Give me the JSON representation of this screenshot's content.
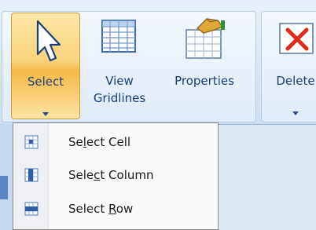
{
  "ribbon": {
    "select": {
      "label": "Select"
    },
    "view_gridlines": {
      "label_line1": "View",
      "label_line2": "Gridlines"
    },
    "properties": {
      "label": "Properties"
    },
    "delete": {
      "label": "Delete"
    }
  },
  "menu": {
    "items": [
      {
        "pre": "Se",
        "u": "l",
        "post": "ect Cell",
        "icon": "select-cell-icon"
      },
      {
        "pre": "Sele",
        "u": "c",
        "post": "t Column",
        "icon": "select-column-icon"
      },
      {
        "pre": "Select ",
        "u": "R",
        "post": "ow",
        "icon": "select-row-icon"
      }
    ]
  },
  "colors": {
    "highlight": "#f9c95c",
    "accent_blue": "#15428b"
  }
}
